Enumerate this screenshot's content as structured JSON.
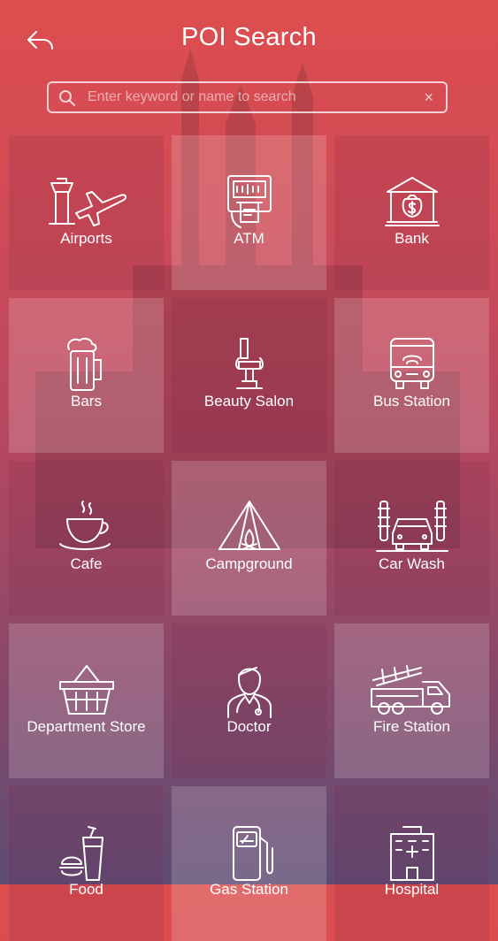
{
  "header": {
    "title": "POI Search"
  },
  "search": {
    "placeholder": "Enter keyword or name to search",
    "value": "",
    "clear_label": "×"
  },
  "categories": [
    {
      "label": "Airports",
      "icon": "airport-icon"
    },
    {
      "label": "ATM",
      "icon": "atm-icon"
    },
    {
      "label": "Bank",
      "icon": "bank-icon"
    },
    {
      "label": "Bars",
      "icon": "beer-mug-icon"
    },
    {
      "label": "Beauty Salon",
      "icon": "salon-chair-icon"
    },
    {
      "label": "Bus Station",
      "icon": "bus-icon"
    },
    {
      "label": "Cafe",
      "icon": "coffee-cup-icon"
    },
    {
      "label": "Campground",
      "icon": "tent-icon"
    },
    {
      "label": "Car Wash",
      "icon": "car-wash-icon"
    },
    {
      "label": "Department Store",
      "icon": "shopping-basket-icon"
    },
    {
      "label": "Doctor",
      "icon": "doctor-icon"
    },
    {
      "label": "Fire Station",
      "icon": "fire-truck-icon"
    },
    {
      "label": "Food",
      "icon": "fast-food-icon"
    },
    {
      "label": "Gas Station",
      "icon": "gas-pump-icon"
    },
    {
      "label": "Hospital",
      "icon": "hospital-icon"
    }
  ],
  "colors": {
    "gradient_top": "#dd4d4e",
    "gradient_bottom": "#5e4b74",
    "text": "#ffffff"
  }
}
